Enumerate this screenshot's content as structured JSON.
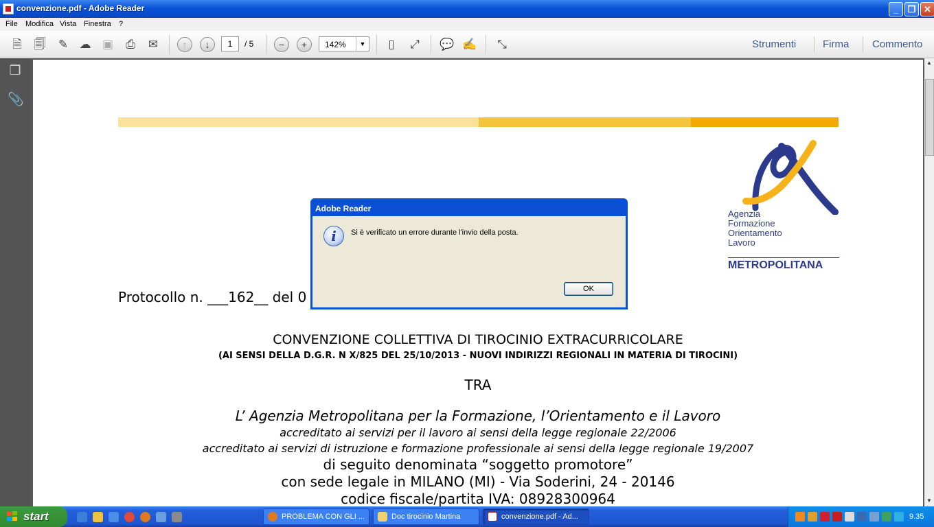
{
  "window": {
    "title": "convenzione.pdf - Adobe Reader"
  },
  "menu": [
    "File",
    "Modifica",
    "Vista",
    "Finestra",
    "?"
  ],
  "toolbar": {
    "page_current": "1",
    "page_total": "/ 5",
    "zoom": "142%",
    "right_links": [
      "Strumenti",
      "Firma",
      "Commento"
    ]
  },
  "document": {
    "protocol": "Protocollo n. ___162__ del 0",
    "title": "CONVENZIONE COLLETTIVA DI TIROCINIO EXTRACURRICOLARE",
    "subtitle": "(AI SENSI DELLA D.G.R. N X/825  DEL 25/10/2013 - NUOVI INDIRIZZI REGIONALI IN MATERIA DI TIROCINI)",
    "tra": "TRA",
    "agency": "L’ Agenzia Metropolitana per la Formazione, l’Orientamento e il Lavoro",
    "line1": "accreditato ai servizi per il lavoro ai sensi della legge regionale 22/2006",
    "line2": "accreditato ai servizi di istruzione e formazione professionale ai sensi della legge regionale 19/2007",
    "line3": "di seguito denominata “soggetto promotore”",
    "line4": "con sede legale in MILANO (MI) - Via Soderini, 24 - 20146",
    "line5": "codice fiscale/partita IVA: 08928300964",
    "logo_lines": [
      "Agenzia",
      "Formazione",
      "Orientamento",
      "Lavoro"
    ],
    "logo_footer": "METROPOLITANA"
  },
  "dialog": {
    "title": "Adobe Reader",
    "message": "Si è verificato un errore durante l'invio della posta.",
    "ok": "OK"
  },
  "taskbar": {
    "start": "start",
    "tasks": [
      "PROBLEMA CON GLI ...",
      "Doc tirocinio Martina",
      "convenzione.pdf - Ad..."
    ],
    "clock": "9.35"
  },
  "colors": {
    "bar_light": "#fbe19a",
    "bar_mid": "#f6c43c",
    "bar_dark": "#f2a900",
    "logo_blue": "#2b3a8c",
    "logo_yellow": "#f5b21a"
  }
}
